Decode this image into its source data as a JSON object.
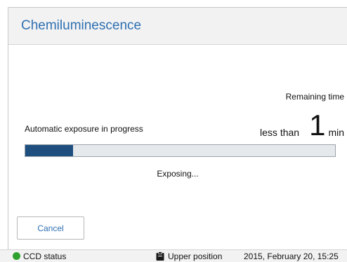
{
  "window": {
    "title": "Chemiluminescence"
  },
  "exposure": {
    "remaining_label": "Remaining time",
    "progress_label": "Automatic exposure in progress",
    "time_prefix": "less than",
    "time_value": "1",
    "time_unit": "min",
    "progress_fraction": 0.155,
    "status_text": "Exposing..."
  },
  "buttons": {
    "cancel_label": "Cancel"
  },
  "status_bar": {
    "ccd_label": "CCD status",
    "ccd_color": "#2fa12f",
    "position_icon": "clipboard-icon",
    "position_label": "Upper position",
    "datetime": "2015, February 20, 15:25"
  },
  "colors": {
    "accent": "#2e6fb2",
    "progress_fill": "#1e4f7f"
  }
}
